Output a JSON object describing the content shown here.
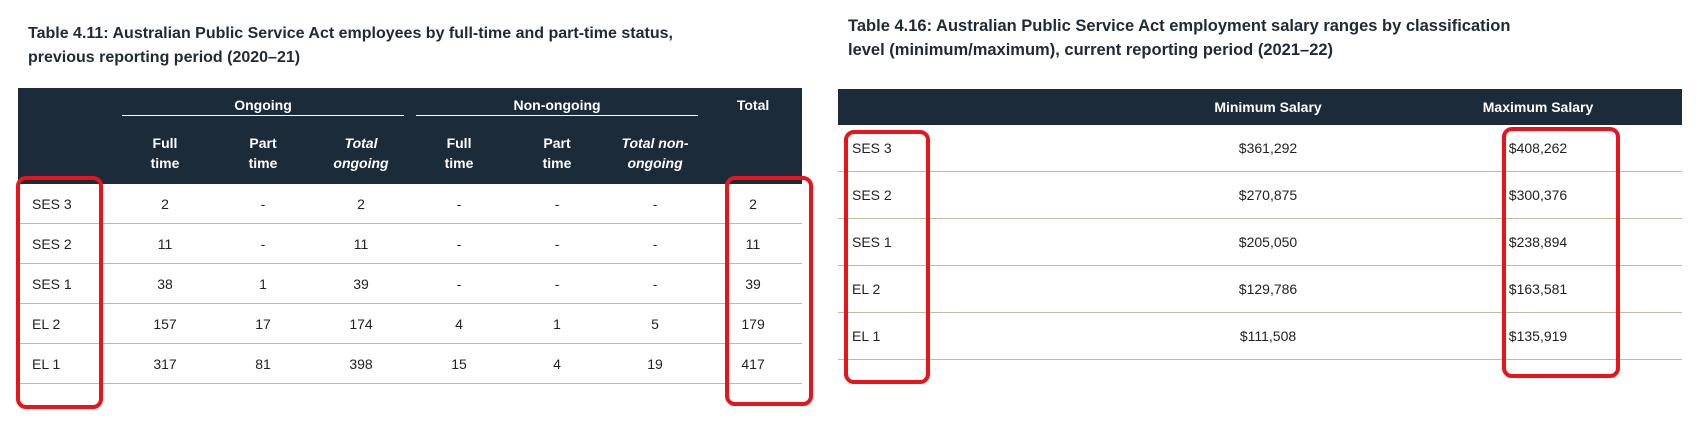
{
  "left_table": {
    "title_line1": "Table 4.11: Australian Public Service Act employees by full-time and part-time status,",
    "title_line2": "previous reporting period (2020–21)",
    "group_headers": {
      "ongoing": "Ongoing",
      "non_ongoing": "Non-ongoing",
      "total": "Total"
    },
    "sub_headers": {
      "full_time": [
        "Full",
        "time"
      ],
      "part_time": [
        "Part",
        "time"
      ],
      "total_ongoing": [
        "Total",
        "ongoing"
      ],
      "total_non_ongoing": [
        "Total non-",
        "ongoing"
      ]
    },
    "rows": [
      {
        "label": "SES 3",
        "cells": [
          "2",
          "-",
          "2",
          "-",
          "-",
          "-",
          "2"
        ]
      },
      {
        "label": "SES 2",
        "cells": [
          "11",
          "-",
          "11",
          "-",
          "-",
          "-",
          "11"
        ]
      },
      {
        "label": "SES 1",
        "cells": [
          "38",
          "1",
          "39",
          "-",
          "-",
          "-",
          "39"
        ]
      },
      {
        "label": "EL 2",
        "cells": [
          "157",
          "17",
          "174",
          "4",
          "1",
          "5",
          "179"
        ]
      },
      {
        "label": "EL 1",
        "cells": [
          "317",
          "81",
          "398",
          "15",
          "4",
          "19",
          "417"
        ]
      }
    ]
  },
  "right_table": {
    "title_line1": "Table 4.16: Australian Public Service Act employment salary ranges by classification",
    "title_line2": "level (minimum/maximum), current reporting period (2021–22)",
    "headers": {
      "min": "Minimum Salary",
      "max": "Maximum Salary"
    },
    "rows": [
      {
        "label": "SES 3",
        "min": "$361,292",
        "max": "$408,262"
      },
      {
        "label": "SES 2",
        "min": "$270,875",
        "max": "$300,376"
      },
      {
        "label": "SES 1",
        "min": "$205,050",
        "max": "$238,894"
      },
      {
        "label": "EL 2",
        "min": "$129,786",
        "max": "$163,581"
      },
      {
        "label": "EL 1",
        "min": "$111,508",
        "max": "$135,919"
      }
    ]
  },
  "highlight_color": "#e8141c",
  "header_bg_color": "#1c2b3a"
}
